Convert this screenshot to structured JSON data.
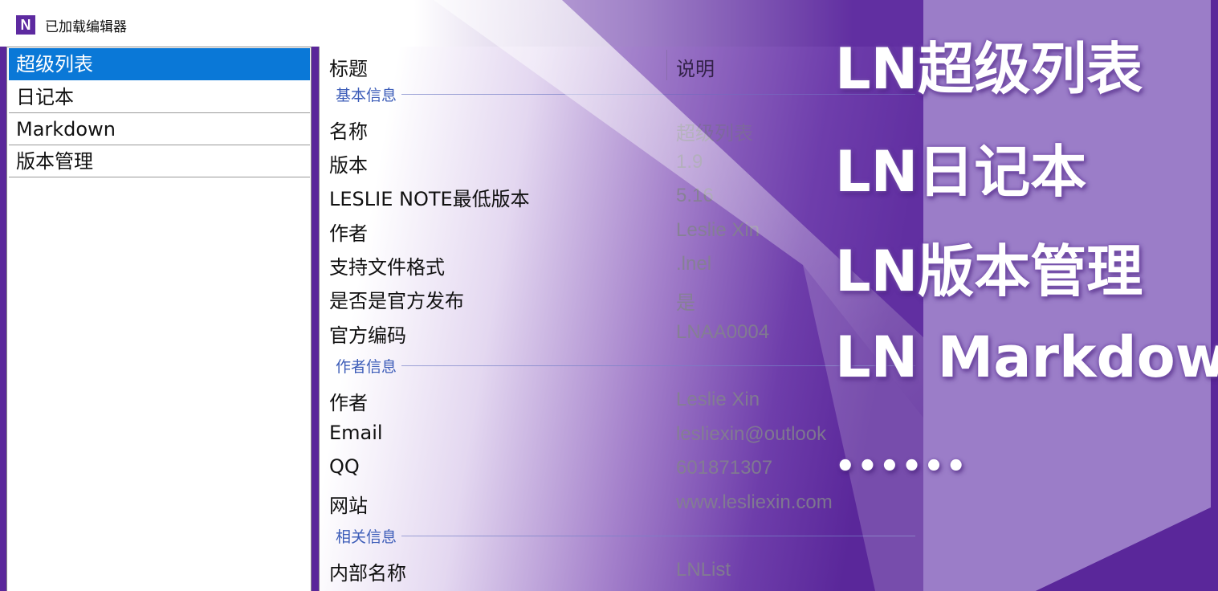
{
  "window": {
    "title": "已加载编辑器",
    "icon": "N"
  },
  "sidebar": {
    "items": [
      {
        "label": "超级列表",
        "selected": true
      },
      {
        "label": "日记本",
        "selected": false
      },
      {
        "label": "Markdown",
        "selected": false
      },
      {
        "label": "版本管理",
        "selected": false
      }
    ]
  },
  "detail": {
    "headers": {
      "title": "标题",
      "description": "说明"
    },
    "groups": [
      {
        "label": "基本信息",
        "rows": [
          {
            "name": "名称",
            "value": "超级列表"
          },
          {
            "name": "版本",
            "value": "1.9"
          },
          {
            "name": "LESLIE NOTE最低版本",
            "value": "5.16"
          },
          {
            "name": "作者",
            "value": "Leslie Xin"
          },
          {
            "name": "支持文件格式",
            "value": ".lnel"
          },
          {
            "name": "是否是官方发布",
            "value": "是"
          },
          {
            "name": "官方编码",
            "value": "LNAA0004"
          }
        ]
      },
      {
        "label": "作者信息",
        "rows": [
          {
            "name": "作者",
            "value": "Leslie Xin"
          },
          {
            "name": "Email",
            "value": "lesliexin@outlook"
          },
          {
            "name": "QQ",
            "value": "601871307"
          },
          {
            "name": "网站",
            "value": "www.lesliexin.com"
          }
        ]
      },
      {
        "label": "相关信息",
        "rows": [
          {
            "name": "内部名称",
            "value": "LNList"
          }
        ]
      }
    ]
  },
  "promo": {
    "lines": [
      "LN超级列表",
      "LN日记本",
      "LN版本管理",
      "LN Markdown"
    ],
    "ellipsis": "••••••"
  },
  "colors": {
    "accent_purple": "#5a279a",
    "selection_blue": "#0a78d7",
    "group_label_blue": "#3c5cb8"
  }
}
